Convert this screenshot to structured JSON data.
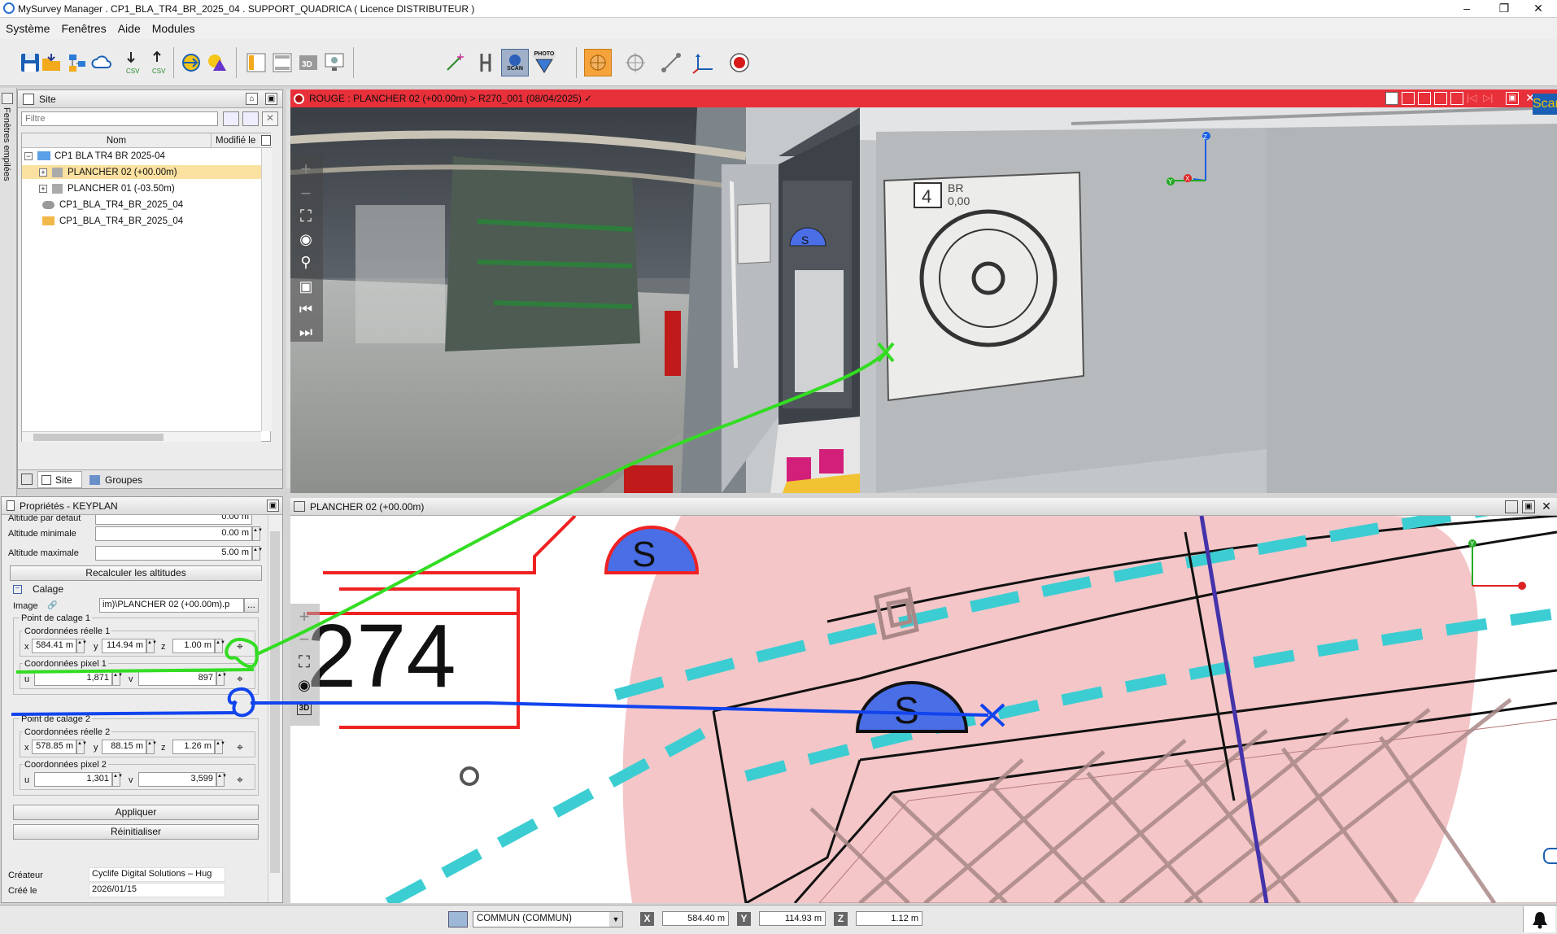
{
  "window": {
    "title": "MySurvey Manager .  CP1_BLA_TR4_BR_2025_04 .  SUPPORT_QUADRICA ( Licence DISTRIBUTEUR )",
    "minimize": "–",
    "maximize": "❐",
    "close": "✕"
  },
  "menu": [
    "Système",
    "Fenêtres",
    "Aide",
    "Modules"
  ],
  "toolbar": {
    "scan_label": "SCAN",
    "photo_label": "PHOTO",
    "csv": "CSV",
    "threed": "3D"
  },
  "side_tab": "Fenêtres empilées",
  "site_panel": {
    "title": "Site",
    "filter_placeholder": "Filtre",
    "col_name": "Nom",
    "col_modified": "Modifié le",
    "tree": [
      {
        "label": "CP1 BLA TR4 BR 2025-04",
        "expander": "−"
      },
      {
        "label": "PLANCHER 02 (+00.00m)",
        "expander": "+"
      },
      {
        "label": "PLANCHER 01 (-03.50m)",
        "expander": "+"
      },
      {
        "label": "CP1_BLA_TR4_BR_2025_04",
        "expander": ""
      },
      {
        "label": "CP1_BLA_TR4_BR_2025_04",
        "expander": ""
      }
    ],
    "tab_site": "Site",
    "tab_groups": "Groupes"
  },
  "properties": {
    "title": "Propriétés - KEYPLAN",
    "alt_default_label": "Altitude par défaut",
    "alt_default_value": "0.00 m",
    "alt_min_label": "Altitude minimale",
    "alt_min_value": "0.00 m",
    "alt_max_label": "Altitude maximale",
    "alt_max_value": "5.00 m",
    "recalc_button": "Recalculer les altitudes",
    "calage_label": "Calage",
    "image_label": "Image",
    "image_value": "im)\\PLANCHER 02 (+00.00m).p",
    "browse": "...",
    "p1_label": "Point de calage 1",
    "real1_label": "Coordonnées réelle 1",
    "pix1_label": "Coordonnées pixel 1",
    "p2_label": "Point de calage 2",
    "real2_label": "Coordonnées réelle 2",
    "pix2_label": "Coordonnées pixel 2",
    "x": "x",
    "y": "y",
    "z": "z",
    "u": "u",
    "v": "v",
    "p1_x": "584.41 m",
    "p1_y": "114.94 m",
    "p1_z": "1.00 m",
    "p1_u": "1,871",
    "p1_v": "897",
    "p2_x": "578.85 m",
    "p2_y": "88.15 m",
    "p2_z": "1.26 m",
    "p2_u": "1,301",
    "p2_v": "3,599",
    "apply_button": "Appliquer",
    "reset_button": "Réinitialiser",
    "creator_label": "Créateur",
    "creator_value": "Cyclife Digital Solutions – Hug",
    "created_label": "Créé le",
    "created_value": "2026/01/15"
  },
  "photo_view": {
    "title": "ROUGE : PLANCHER 02 (+00.00m) > R270_001 (08/04/2025) ✓",
    "scan_badge": "Scan",
    "sign_number": "4",
    "sign_code": "BR",
    "sign_alt": "0,00",
    "marker_letter": "S",
    "axis_z": "Z",
    "axis_y": "Y",
    "axis_x": "X"
  },
  "plan_view": {
    "title": "PLANCHER 02 (+00.00m)",
    "room_label": "274",
    "marker_letter": "S",
    "axis_y": "Y",
    "btn_3d": "3D"
  },
  "status": {
    "layer": "COMMUN (COMMUN)",
    "x_label": "X",
    "x": "584.40 m",
    "y_label": "Y",
    "y": "114.93 m",
    "z_label": "Z",
    "z": "1.12 m"
  },
  "colors": {
    "photo_header": "#e8303a",
    "plan_pink": "#f4c6c8",
    "cyan_line": "#3ccdd2",
    "marker_blue": "#3b62d9",
    "green_annot": "#33dd22",
    "blue_annot": "#1144ee"
  }
}
